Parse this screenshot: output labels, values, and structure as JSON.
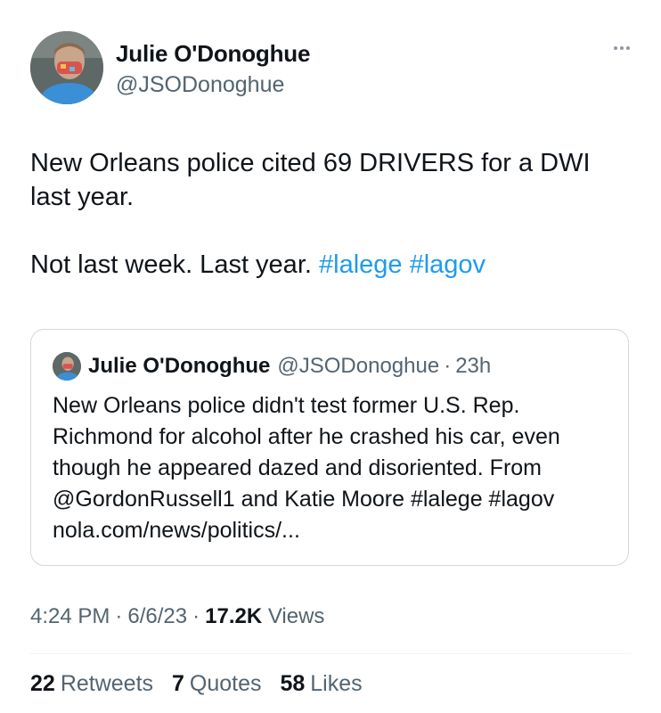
{
  "author": {
    "name": "Julie O'Donoghue",
    "handle": "@JSODonoghue"
  },
  "tweet": {
    "line1": "New Orleans police cited 69 DRIVERS for a DWI last year.",
    "line2_text": "Not last week. Last year.",
    "hashtags": [
      "#lalege",
      "#lagov"
    ]
  },
  "quote": {
    "name": "Julie O'Donoghue",
    "handle": "@JSODonoghue",
    "dot": "·",
    "time": "23h",
    "text": "New Orleans police didn't test former U.S. Rep. Richmond for alcohol after he crashed his car, even though he appeared dazed and disoriented. From @GordonRussell1 and Katie Moore #lalege #lagov nola.com/news/politics/..."
  },
  "meta": {
    "time": "4:24 PM",
    "date": "6/6/23",
    "dot": "·",
    "views_count": "17.2K",
    "views_label": "Views"
  },
  "stats": {
    "retweets_count": "22",
    "retweets_label": "Retweets",
    "quotes_count": "7",
    "quotes_label": "Quotes",
    "likes_count": "58",
    "likes_label": "Likes"
  },
  "colors": {
    "text": "#0f1419",
    "secondary": "#536471",
    "link": "#1d9bf0",
    "border": "#cfd9de"
  },
  "icons": {
    "more": "more-horizontal-icon"
  }
}
